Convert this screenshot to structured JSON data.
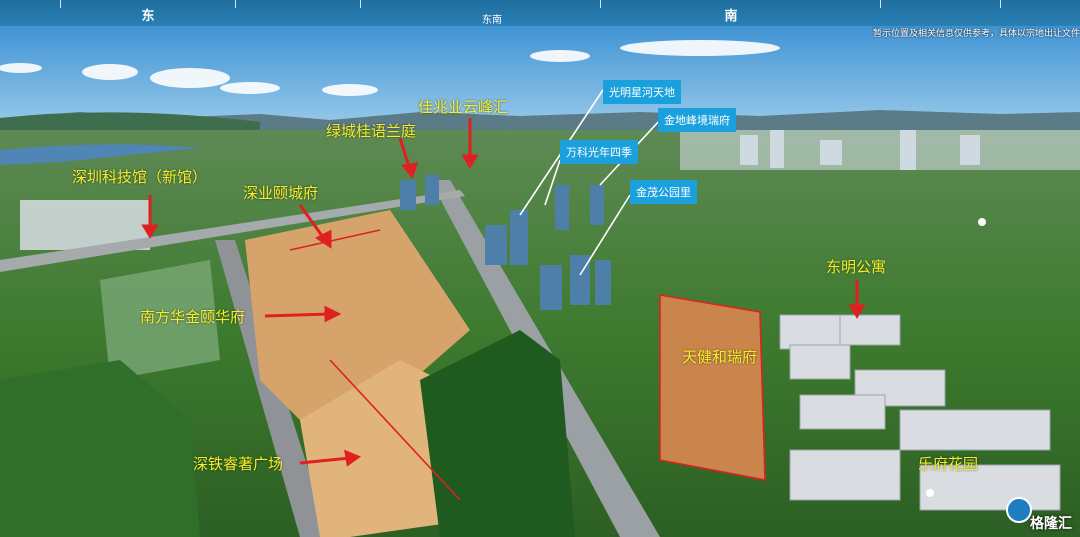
{
  "compass": {
    "east": "东",
    "southeast": "东南",
    "south": "南"
  },
  "disclaimer": "暂示位置及相关信息仅供参考，具体以宗地出让文件",
  "labels": {
    "jiazhao": "佳兆业云峰汇",
    "lvcheng": "绿城桂语兰庭",
    "sztech": "深圳科技馆（新馆）",
    "shenye": "深业颐城府",
    "huafa": "南方华金颐华府",
    "shentie": "深铁睿著广场",
    "tianjian": "天健和瑞府",
    "dongming": "东明公寓",
    "lefu": "乐府花园"
  },
  "tags": {
    "guangming": "光明星河天地",
    "jindi": "金地峰境瑞府",
    "vanke": "万科光年四季",
    "jinmao": "金茂公园里"
  },
  "logo": "格隆汇"
}
